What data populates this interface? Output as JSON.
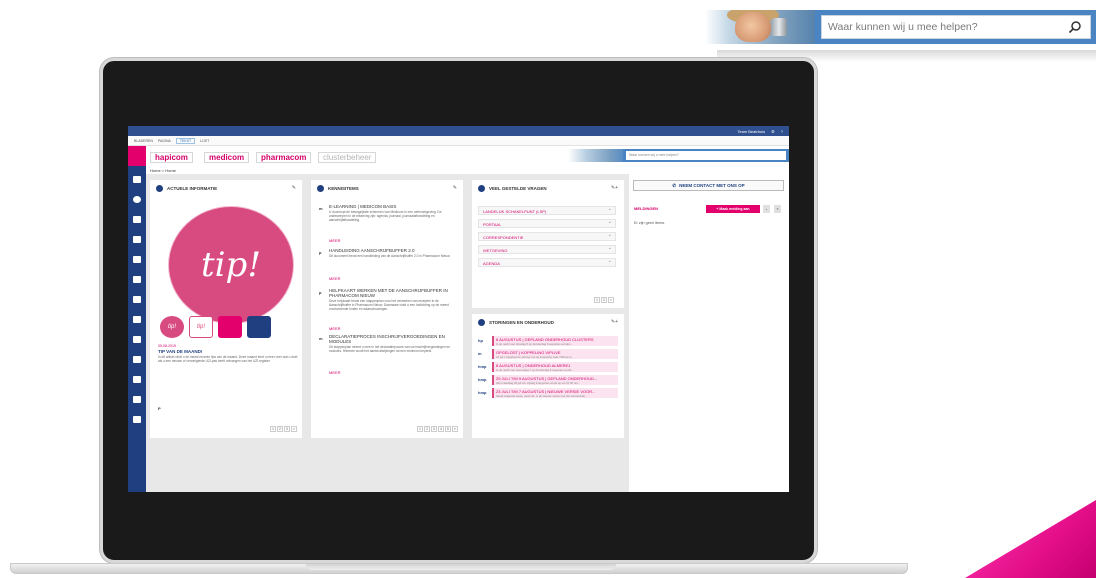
{
  "banner": {
    "search_placeholder": "Waar kunnen wij u mee helpen?"
  },
  "screen": {
    "user": "Team Beatrhuis",
    "ribbon_tabs": [
      "BLADEREN",
      "PAGINA",
      "TEKST",
      "LIJST"
    ],
    "brands": [
      "hapicom",
      "medicom",
      "pharmacom",
      "clusterbeheer"
    ],
    "mini_search_placeholder": "Waar kunnen wij u mee helpen?",
    "breadcrumb": "Home > Home",
    "actuele": {
      "title": "ACTUELE INFORMATIE",
      "tip_text": "tip!",
      "thumbs": [
        "tip!",
        "tip!",
        "",
        ""
      ],
      "news_date": "05-08-2015",
      "news_title": "TIP VAN DE MAAND!",
      "news_text": "In dit artikel vindt u de meest recente tips van de maand. Deze maand leert u meer over wat u doet als u een nieuwe of vervangende UZI-pas heeft ontvangen van het UZI-register.",
      "p_label": "P",
      "pager": [
        "1",
        "2",
        "3",
        "»"
      ]
    },
    "kennis": {
      "title": "KENNISITEMS",
      "items": [
        {
          "letter": "m",
          "title": "E-LEARNING | MEDICOM BASIS",
          "desc": "U doorloopt de belangrijkste schermen van Medicom in een oefenomgeving. De onderwerpen in de elearning zijn: agenda, journaal, journaalafhandeling en aanschrijfafhandeling.",
          "more": "MEER"
        },
        {
          "letter": "p",
          "title": "HANDLEIDING AANSCHRIJFBUFFER 2.0",
          "desc": "Dit document bevat een handleiding van de Aanschrijfbuffer 2.0 in Pharmacom Nieuw.",
          "more": "MEER"
        },
        {
          "letter": "p",
          "title": "HELPKAART WERKEN MET DE AANSCHRIJFBUFFER IN PHARMACOM NIEUW",
          "desc": "Deze helpkaart bevat een stappenplan voor het verwerken van recepten in de Aanschrijfbuffer in Pharmacom Nieuw. Daarnaast vindt u een toelichting op de meest voorkomende fouten en waarschuwingen.",
          "more": "MEER"
        },
        {
          "letter": "m",
          "title": "DECLARATIEPROCES INSCHRIJFVERGOEDINGEN EN MODULES",
          "desc": "Dit stappenplan neemt u mee in het declaratieproces van uw inschrijfvergoedingen en modules. Hiermee wordt het aantal afwijzingen tot een minimum beperkt.",
          "more": "MEER"
        }
      ],
      "pager": [
        "1",
        "2",
        "3",
        "4",
        "5",
        "»"
      ]
    },
    "faq": {
      "title": "VEEL GESTELDE VRAGEN",
      "items": [
        "LANDELIJK SCHAKELPUNT (LSP)",
        "PORTAAL",
        "CORRESPONDENTIE",
        "WETGEVING",
        "AGENDA"
      ],
      "pager": [
        "1",
        "2",
        "»"
      ]
    },
    "storingen": {
      "title": "STORINGEN EN ONDERHOUD",
      "items": [
        {
          "abbr": "hp",
          "title": "6 AUGUSTUS | GEPLAND ONDERHOUD CLUSTERS",
          "sub": "In de nacht van dinsdag 5 op donderdag 6 augustus worden..."
        },
        {
          "abbr": "m",
          "title": "OPGELOST | KOPPELING VIPLIVE",
          "sub": "31 juli | Opgelost de storing met de koppeling naar VIPLive is..."
        },
        {
          "abbr": "hmp",
          "title": "8 AUGUSTUS | ONDERHOUD ALMERE1",
          "sub": "In de nacht van woensdag 7 op donderdag 8 augustus wordt..."
        },
        {
          "abbr": "hmp",
          "title": "29 JULI T/M 9 AUGUSTUS | GEPLAND ONDERHOUD...",
          "sub": "Van maandag 29 juli t/m vrijdag 9 augustus wordt op wo 07:00 uur..."
        },
        {
          "abbr": "hmp",
          "title": "23 JULI T/M 7 AUGUSTUS | NIEUWE VERSIE VOOR...",
          "sub": "Vanaf volgende week, week 31, is de nieuwe versie met het vernieuwde..."
        }
      ]
    },
    "contact_button": "NEEM CONTACT MET ONS OP",
    "meldingen": {
      "label": "MELDINGEN",
      "button": "+ Maak melding aan",
      "empty": "Er zijn geen items."
    }
  }
}
